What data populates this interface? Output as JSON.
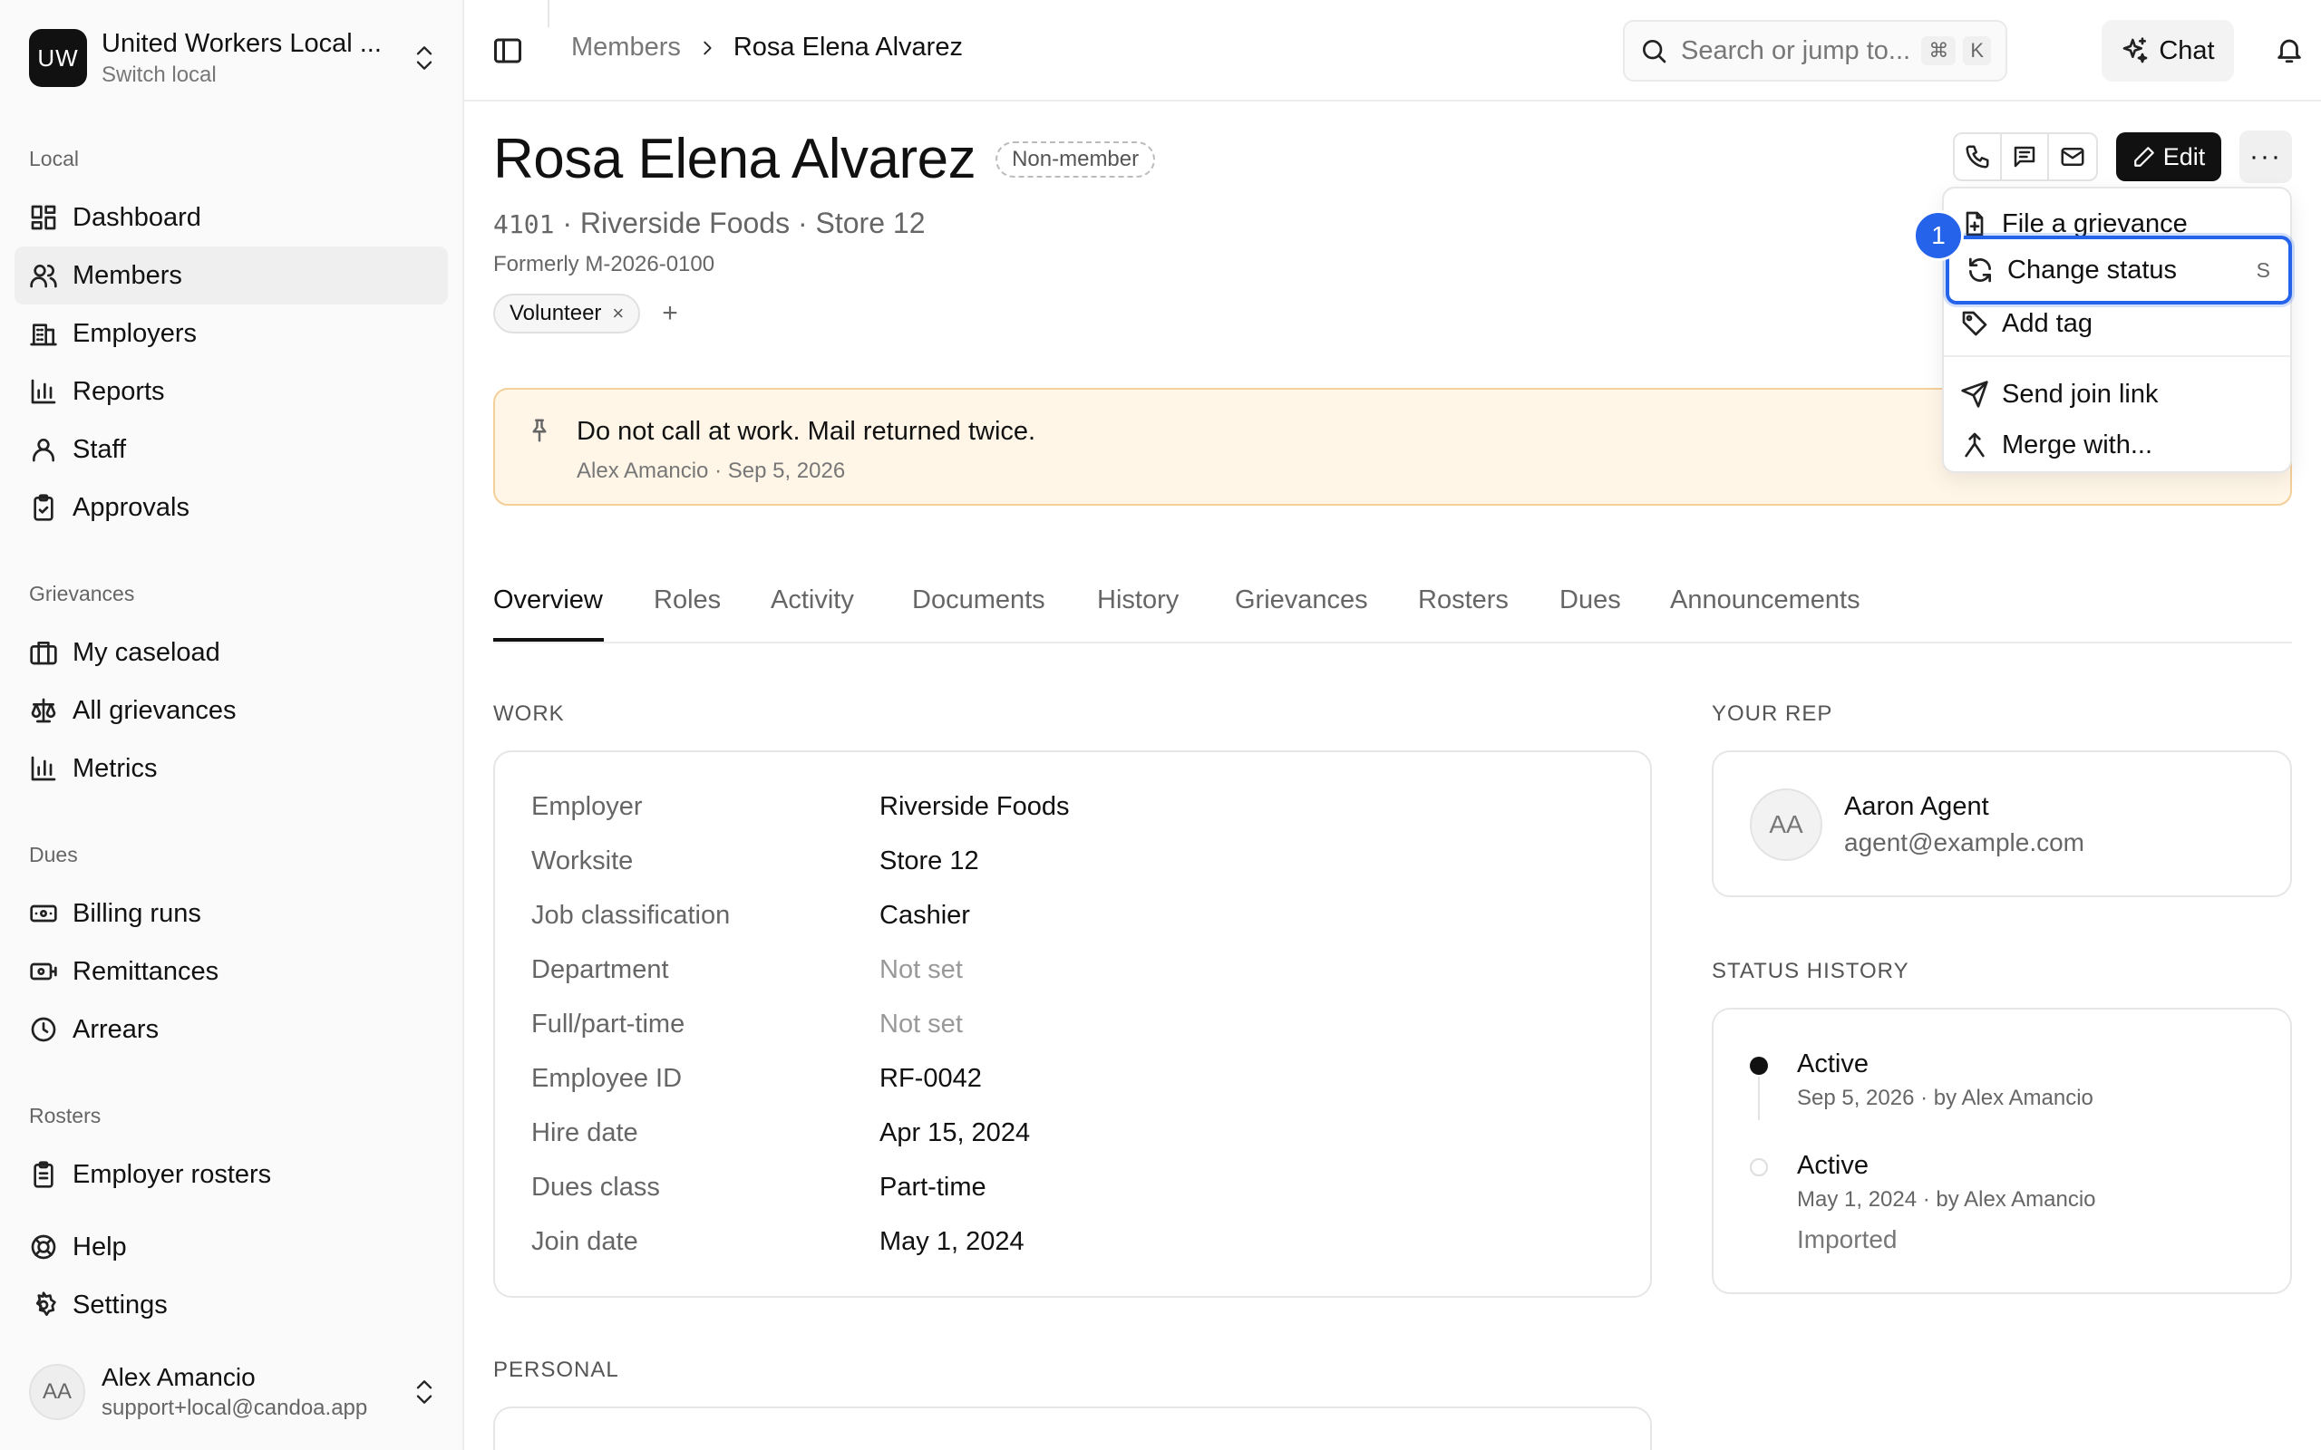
{
  "sidebar": {
    "org_initials": "UW",
    "org_name": "United Workers Local ...",
    "org_sub": "Switch local",
    "sections": {
      "local": "Local",
      "grievances": "Grievances",
      "dues": "Dues",
      "rosters": "Rosters"
    },
    "items": {
      "dashboard": "Dashboard",
      "members": "Members",
      "employers": "Employers",
      "reports": "Reports",
      "staff": "Staff",
      "approvals": "Approvals",
      "my_caseload": "My caseload",
      "all_grievances": "All grievances",
      "metrics": "Metrics",
      "billing_runs": "Billing runs",
      "remittances": "Remittances",
      "arrears": "Arrears",
      "employer_rosters": "Employer rosters",
      "help": "Help",
      "settings": "Settings"
    },
    "user": {
      "initials": "AA",
      "name": "Alex Amancio",
      "email": "support+local@candoa.app"
    }
  },
  "topbar": {
    "breadcrumb_parent": "Members",
    "breadcrumb_current": "Rosa Elena Alvarez",
    "search_placeholder": "Search or jump to...",
    "search_kbd_1": "⌘",
    "search_kbd_2": "K",
    "chat_label": "Chat"
  },
  "member": {
    "name": "Rosa Elena Alvarez",
    "status_badge": "Non-member",
    "id": "4101",
    "employer_line": "· Riverside Foods · Store 12",
    "formerly": "Formerly M-2026-0100",
    "tag": "Volunteer",
    "tag_remove": "×",
    "tag_add": "+",
    "edit_label": "Edit",
    "more_label": "···"
  },
  "notice": {
    "text": "Do not call at work. Mail returned twice.",
    "meta": "Alex Amancio · Sep 5, 2026"
  },
  "menu": {
    "file_grievance": "File a grievance",
    "change_status": "Change status",
    "change_status_shortcut": "S",
    "add_tag": "Add tag",
    "send_join_link": "Send join link",
    "merge_with": "Merge with...",
    "step_badge": "1"
  },
  "tabs": [
    "Overview",
    "Roles",
    "Activity",
    "Documents",
    "History",
    "Grievances",
    "Rosters",
    "Dues",
    "Announcements"
  ],
  "work": {
    "label": "WORK",
    "rows": [
      {
        "label": "Employer",
        "value": "Riverside Foods"
      },
      {
        "label": "Worksite",
        "value": "Store 12"
      },
      {
        "label": "Job classification",
        "value": "Cashier"
      },
      {
        "label": "Department",
        "value": "Not set"
      },
      {
        "label": "Full/part-time",
        "value": "Not set"
      },
      {
        "label": "Employee ID",
        "value": "RF-0042"
      },
      {
        "label": "Hire date",
        "value": "Apr 15, 2024"
      },
      {
        "label": "Dues class",
        "value": "Part-time"
      },
      {
        "label": "Join date",
        "value": "May 1, 2024"
      }
    ]
  },
  "rep": {
    "label": "YOUR REP",
    "initials": "AA",
    "name": "Aaron Agent",
    "email": "agent@example.com"
  },
  "status_history": {
    "label": "STATUS HISTORY",
    "entries": [
      {
        "status": "Active",
        "meta": "Sep 5, 2026 · by Alex Amancio"
      },
      {
        "status": "Active",
        "meta": "May 1, 2024 · by Alex Amancio",
        "note": "Imported"
      }
    ]
  },
  "personal": {
    "label": "PERSONAL"
  }
}
